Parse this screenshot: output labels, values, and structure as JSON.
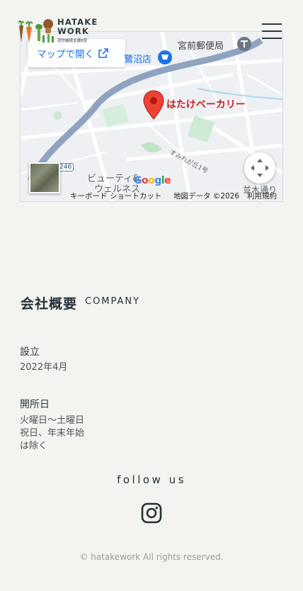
{
  "header": {
    "logo_line1": "HATAKE",
    "logo_line2": "WORK",
    "logo_sub": "就労継続支援B型",
    "brand_colors": [
      "#4c9a3e",
      "#e07a2a",
      "#8a5a2b",
      "#2e3a40"
    ]
  },
  "map": {
    "open_label": "マップで開く",
    "poi_postoffice": "宮前郵便局",
    "poi_store": "鷺沼店",
    "pin_label": "はたけベーカリー",
    "road_label": "すみれが丘1号",
    "route_number": "246",
    "poi_beauty_line1": "ビューティ&",
    "poi_beauty_line2": "ウェルネス",
    "poi_street": "並木通り",
    "logo_text": "Google",
    "footer_shortcuts": "キーボード ショートカット",
    "footer_data": "地図データ ©2026",
    "footer_terms": "利用規約"
  },
  "company": {
    "heading_ja": "会社概要",
    "heading_en": "COMPANY",
    "founded_label": "設立",
    "founded_value": "2022年4月",
    "open_days_label": "開所日",
    "open_days_line1": "火曜日〜土曜日",
    "open_days_line2": "祝日、年末年始",
    "open_days_line3": "は除く"
  },
  "footer": {
    "follow_text": "follow us",
    "instagram_icon": "instagram-icon",
    "copyright": "© hatakework All rights reserved."
  }
}
